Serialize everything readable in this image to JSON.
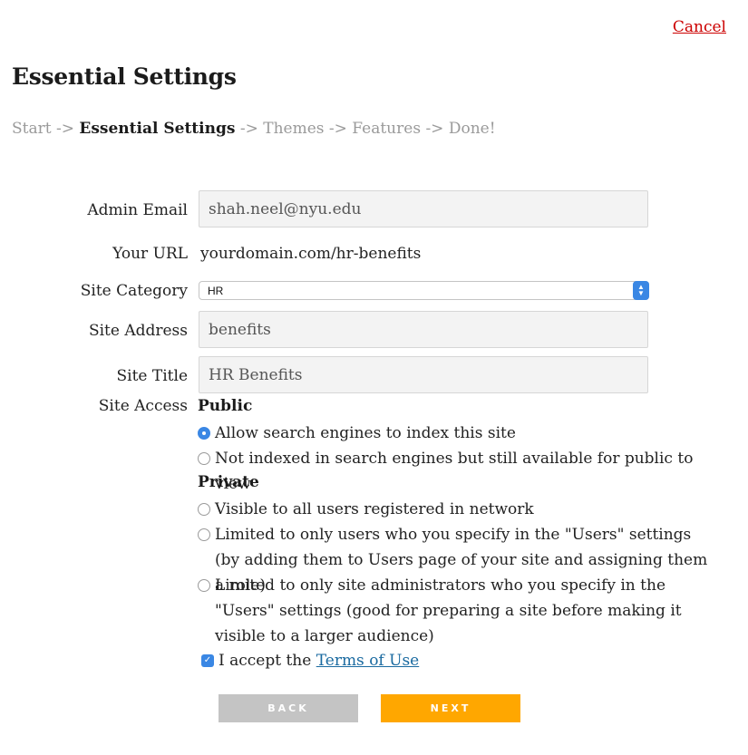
{
  "header": {
    "cancel_label": "Cancel",
    "title": "Essential Settings"
  },
  "breadcrumb": {
    "start": "Start ->",
    "current": "Essential Settings",
    "rest": "-> Themes -> Features -> Done!"
  },
  "form": {
    "admin_email": {
      "label": "Admin Email",
      "value": "shah.neel@nyu.edu"
    },
    "your_url": {
      "label": "Your URL",
      "value": "yourdomain.com/hr-benefits"
    },
    "site_category": {
      "label": "Site Category",
      "selected": "HR"
    },
    "site_address": {
      "label": "Site Address",
      "value": "benefits"
    },
    "site_title": {
      "label": "Site Title",
      "value": "HR Benefits"
    },
    "site_access": {
      "label": "Site Access",
      "public_heading": "Public",
      "private_heading": "Private",
      "options": [
        {
          "label": "Allow search engines to index this site",
          "checked": true
        },
        {
          "label": "Not indexed in search engines but still available for public to view",
          "checked": false
        },
        {
          "label": "Visible to all users registered in network",
          "checked": false
        },
        {
          "label": "Limited to only users who you specify in the \"Users\" settings (by adding them to Users page of your site and assigning them a role)",
          "checked": false
        },
        {
          "label": "Limited to only site administrators who you specify in the \"Users\" settings (good for preparing a site before making it visible to a larger audience)",
          "checked": false
        }
      ]
    },
    "terms": {
      "prefix": "I accept the",
      "link_label": "Terms of Use",
      "checked": true
    }
  },
  "buttons": {
    "back_label": "BACK",
    "next_label": "NEXT"
  },
  "colors": {
    "accent": "#3a87e4",
    "next_button": "#ffa700",
    "back_button": "#c4c4c4",
    "cancel_link": "#cc0000"
  },
  "icons": {
    "select": "chevron-up-down-icon",
    "checkbox": "checkmark-icon"
  }
}
